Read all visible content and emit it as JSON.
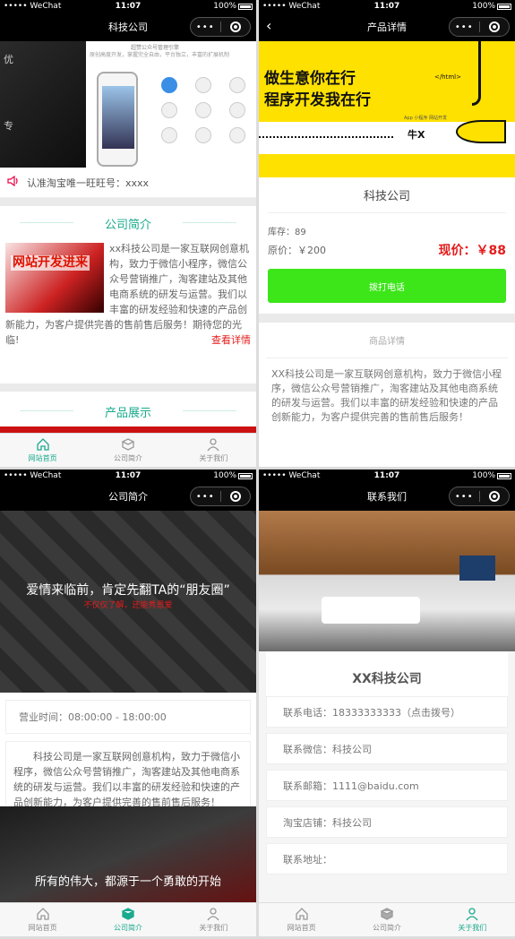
{
  "status": {
    "carrier": "••••• WeChat",
    "time": "11:07",
    "battery": "100%"
  },
  "capsule": {
    "dots": "•••"
  },
  "tabs": [
    {
      "label": "网站首页"
    },
    {
      "label": "公司简介"
    },
    {
      "label": "关于我们"
    }
  ],
  "p1": {
    "nav_title": "科技公司",
    "notice": "认准淘宝唯一旺旺号：xxxx",
    "section_intro": "公司简介",
    "intro_text": "xx科技公司是一家互联网创意机构，致力于微信小程序，微信公众号营销推广，淘客建站及其他电商系统的研发与运营。我们以丰富的研发经验和快速的产品创新能力，为客户提供完善的售前售后服务！期待您的光临!",
    "more": "查看详情",
    "section_products": "产品展示",
    "banner_left_1": "优",
    "banner_left_2": "专",
    "banner_title": "超赞公众号管理引擎",
    "banner_sub": "原创高度开发，掌握完全自由，平台独立，丰富的扩展机制",
    "img_text": "网站开发进来"
  },
  "p2": {
    "nav_title": "产品详情",
    "back": "‹",
    "banner_line1": "做生意你在行",
    "banner_line2": "程序开发我在行",
    "banner_html": "</html>",
    "banner_sub": "App 小程序 网站开发",
    "banner_nx": "牛X",
    "product_name": "科技公司",
    "stock": "库存：89",
    "original_price": "原价：￥200",
    "price": "现价：￥88",
    "call": "拨打电话",
    "detail_title": "商品详情",
    "desc": "XX科技公司是一家互联网创意机构，致力于微信小程序，微信公众号营销推广，淘客建站及其他电商系统的研发与运营。我们以丰富的研发经验和快速的产品创新能力，为客户提供完善的售前售后服务！"
  },
  "p3": {
    "nav_title": "公司简介",
    "banner_caption": "爱情来临前，肯定先翻TA的“朋友圈”",
    "banner_sub": "不仅仅了解，还能秀恩爱",
    "hours": "营业时间：08:00:00 - 18:00:00",
    "intro": "科技公司是一家互联网创意机构，致力于微信小程序，微信公众号营销推广，淘客建站及其他电商系统的研发与运营。我们以丰富的研发经验和快速的产品创新能力，为客户提供完善的售前售后服务！",
    "run_caption": "所有的伟大，都源于一个勇敢的开始"
  },
  "p4": {
    "nav_title": "联系我们",
    "company": "XX科技公司",
    "rows": [
      {
        "label": "联系电话：18333333333（点击拨号）"
      },
      {
        "label": "联系微信：科技公司"
      },
      {
        "label": "联系邮箱：1111@baidu.com"
      },
      {
        "label": "淘宝店铺：科技公司"
      },
      {
        "label": "联系地址："
      }
    ]
  },
  "colors": {
    "accent": "#1aaa8d",
    "price": "#e41c1c",
    "call": "#3ce619",
    "banner_yellow": "#ffe100"
  },
  "icons": [
    "home-icon",
    "box-icon",
    "user-icon",
    "speaker-icon",
    "back-arrow-icon"
  ]
}
